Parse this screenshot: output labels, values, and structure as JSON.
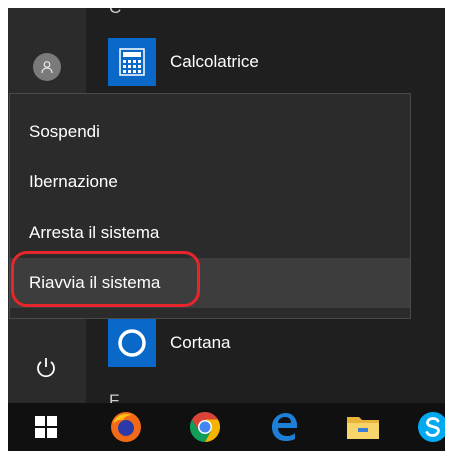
{
  "start_menu": {
    "section_letter_top": "C",
    "section_letter_bottom": "F",
    "apps": [
      {
        "label": "Calcolatrice",
        "icon": "calculator-icon"
      },
      {
        "label": "Cortana",
        "icon": "cortana-icon"
      }
    ],
    "user_icon": "user-icon",
    "power_icon": "power-icon"
  },
  "power_menu": {
    "items": [
      {
        "label": "Sospendi"
      },
      {
        "label": "Ibernazione"
      },
      {
        "label": "Arresta il sistema"
      },
      {
        "label": "Riavvia il sistema",
        "highlighted": true
      }
    ],
    "highlight_color": "#e6262b"
  },
  "taskbar": {
    "items": [
      "windows-start-icon",
      "firefox-icon",
      "chrome-icon",
      "edge-icon",
      "file-explorer-icon",
      "skype-icon"
    ]
  },
  "colors": {
    "accent": "#0a68c8",
    "menu_bg": "#2b2b2b",
    "taskbar_bg": "#101010"
  }
}
